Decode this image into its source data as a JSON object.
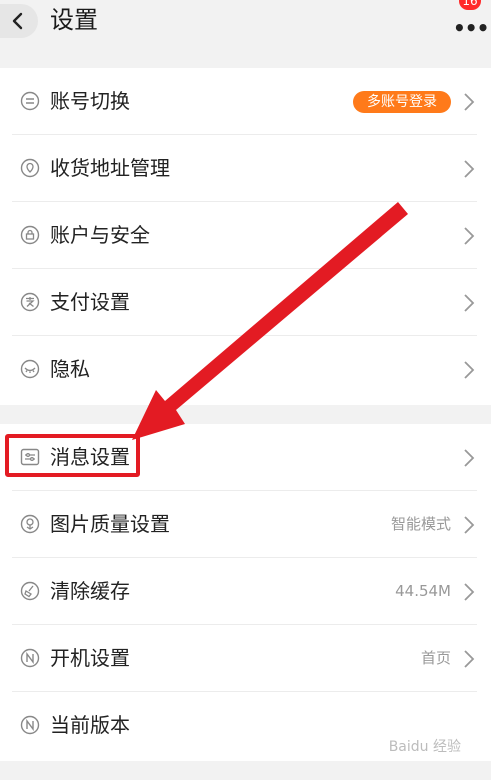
{
  "header": {
    "title": "设置",
    "badge": "16"
  },
  "settings": {
    "account_switch": {
      "label": "账号切换",
      "pill": "多账号登录"
    },
    "address": {
      "label": "收货地址管理"
    },
    "security": {
      "label": "账户与安全"
    },
    "payment": {
      "label": "支付设置"
    },
    "privacy": {
      "label": "隐私"
    },
    "message": {
      "label": "消息设置"
    },
    "image_quality": {
      "label": "图片质量设置",
      "value": "智能模式"
    },
    "cache": {
      "label": "清除缓存",
      "value": "44.54M"
    },
    "startup": {
      "label": "开机设置",
      "value": "首页"
    },
    "version": {
      "label": "当前版本"
    }
  },
  "watermark": "Baidu 经验",
  "colors": {
    "accent_orange": "#ff7a1a",
    "annotation_red": "#e31b23",
    "badge_red": "#ff2a2a"
  }
}
